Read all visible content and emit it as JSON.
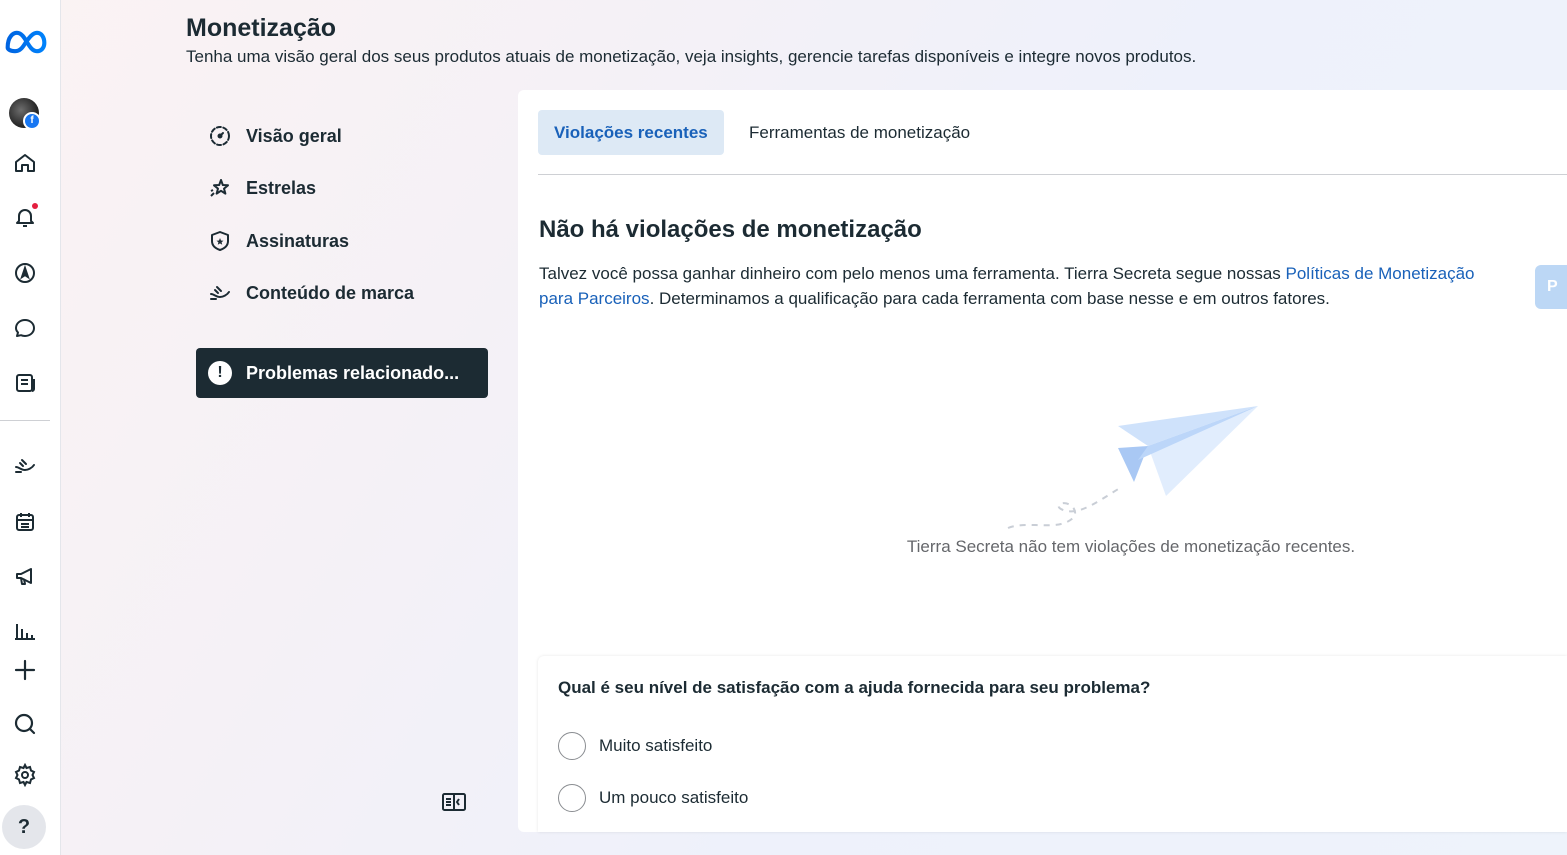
{
  "header": {
    "title": "Monetização",
    "subtitle": "Tenha uma visão geral dos seus produtos atuais de monetização, veja insights, gerencie tarefas disponíveis e integre novos produtos."
  },
  "rail": {
    "icons": [
      "meta-logo-icon",
      "profile-avatar",
      "home-icon",
      "bell-icon",
      "compass-icon",
      "chat-bubble-icon",
      "news-icon",
      "monetization-icon",
      "calendar-icon",
      "megaphone-icon",
      "insights-icon",
      "plus-icon",
      "search-icon",
      "gear-icon",
      "help-icon"
    ],
    "help_label": "?",
    "avatar_badge": "f"
  },
  "nav": {
    "items": [
      {
        "label": "Visão geral",
        "icon": "gauge-icon"
      },
      {
        "label": "Estrelas",
        "icon": "stars-icon"
      },
      {
        "label": "Assinaturas",
        "icon": "shield-icon"
      },
      {
        "label": "Conteúdo de marca",
        "icon": "handshake-icon"
      }
    ],
    "active_item": {
      "label": "Problemas relacionado...",
      "icon": "warning-icon",
      "icon_glyph": "!"
    }
  },
  "tabs": [
    {
      "label": "Violações recentes",
      "active": true
    },
    {
      "label": "Ferramentas de monetização",
      "active": false
    }
  ],
  "section": {
    "title": "Não há violações de monetização",
    "text_before": "Talvez você possa ganhar dinheiro com pelo menos uma ferramenta. Tierra Secreta segue nossas ",
    "link": "Políticas de Monetização para Parceiros",
    "text_after": ". Determinamos a qualificação para cada ferramenta com base nesse e em outros fatores.",
    "cut_button_label": "P"
  },
  "empty_state": {
    "text": "Tierra Secreta não tem violações de monetização recentes.",
    "illustration": "paper-plane-icon"
  },
  "survey": {
    "question": "Qual é seu nível de satisfação com a ajuda fornecida para seu problema?",
    "options": [
      "Muito satisfeito",
      "Um pouco satisfeito"
    ]
  },
  "colors": {
    "accent": "#1961b9",
    "tab_active_bg": "#dde9f5",
    "nav_active_bg": "#1c2b33",
    "meta_blue": "#0866ff",
    "notification": "#e41e3f"
  }
}
